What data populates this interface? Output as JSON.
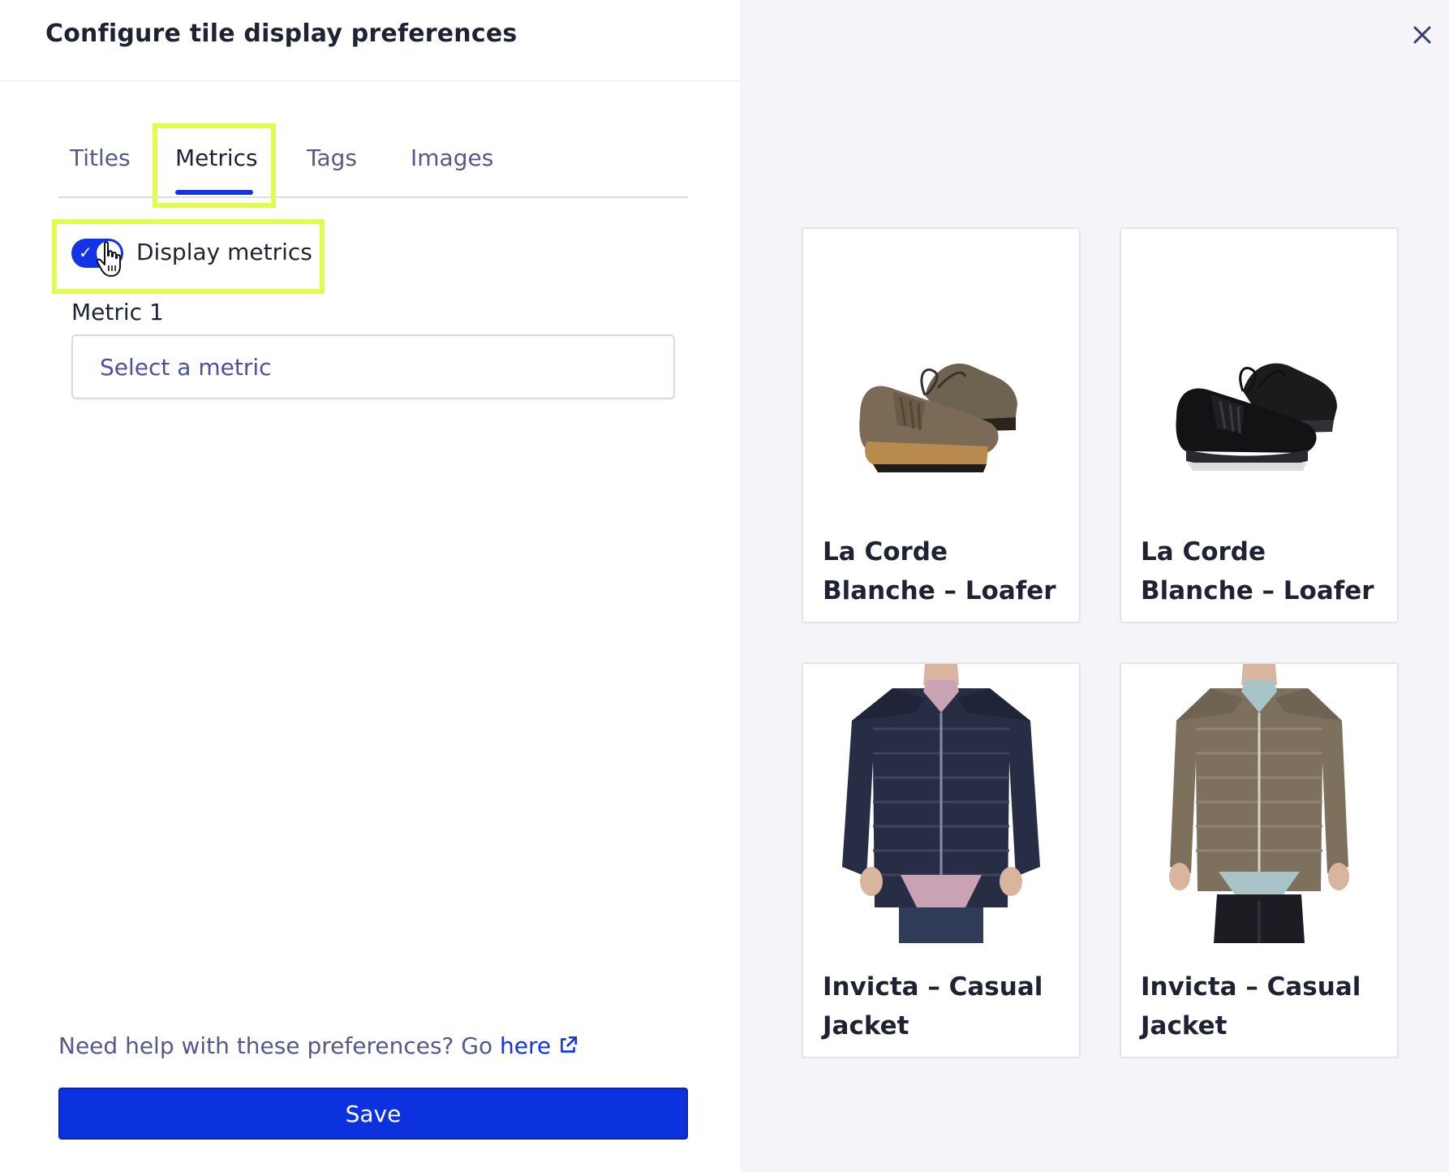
{
  "header": {
    "title": "Configure tile display preferences"
  },
  "tabs": [
    {
      "label": "Titles"
    },
    {
      "label": "Metrics"
    },
    {
      "label": "Tags"
    },
    {
      "label": "Images"
    }
  ],
  "active_tab": "Metrics",
  "display_metrics": {
    "label": "Display metrics",
    "enabled": true
  },
  "metric_1": {
    "label": "Metric 1",
    "placeholder": "Select a metric"
  },
  "help": {
    "text": "Need help with these preferences? Go ",
    "link_label": "here"
  },
  "save_label": "Save",
  "colors": {
    "accent": "#1334e6",
    "highlight": "#e3fb4e",
    "muted_text": "#55598a",
    "panel_bg": "#f5f5f9"
  },
  "preview_tiles": [
    {
      "title": "La Corde Blanche – Loafer",
      "image": "brown-loafer-shoe"
    },
    {
      "title": "La Corde Blanche – Loafer",
      "image": "black-loafer-shoe"
    },
    {
      "title": "Invicta – Casual Jacket",
      "image": "navy-puffer-jacket"
    },
    {
      "title": "Invicta – Casual Jacket",
      "image": "olive-puffer-jacket"
    }
  ]
}
